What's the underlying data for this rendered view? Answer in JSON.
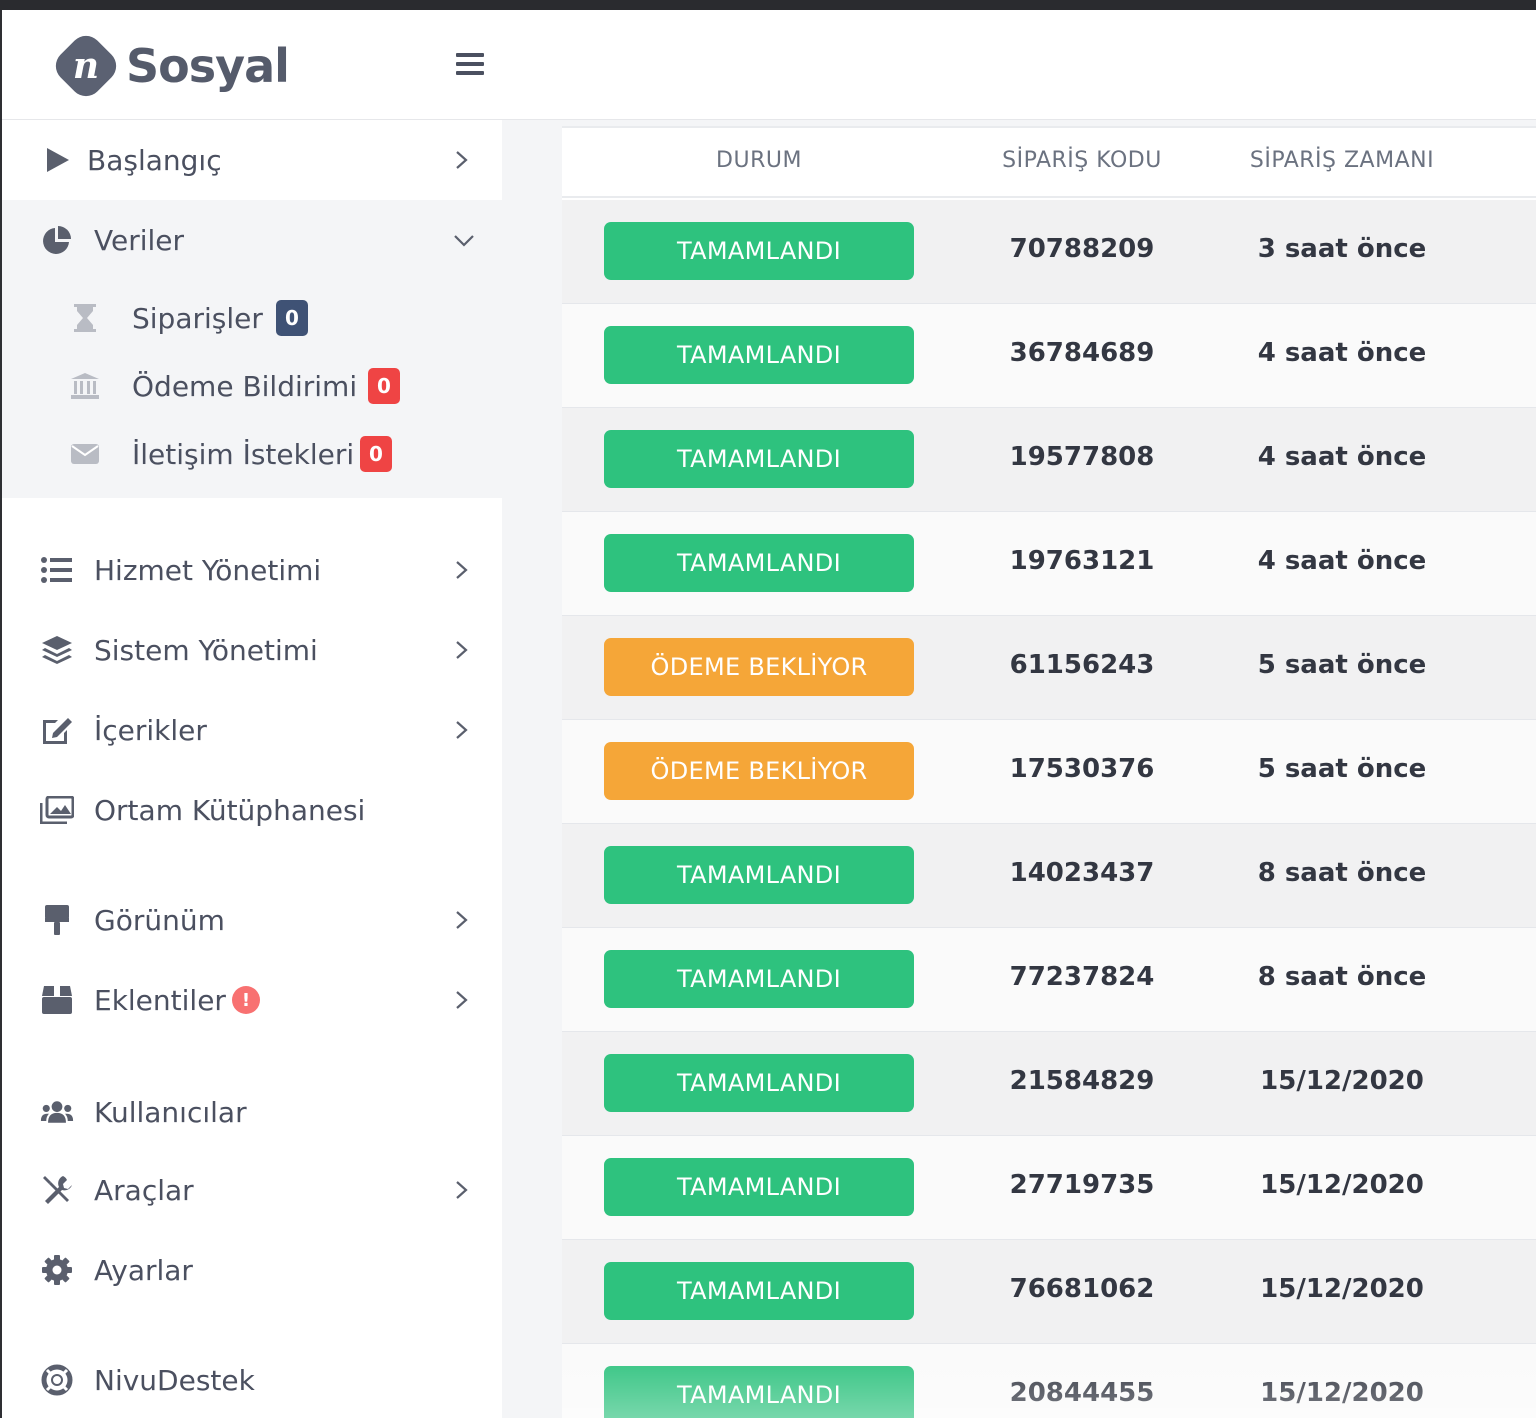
{
  "brand": {
    "name": "Sosyal",
    "logo_letter": "n"
  },
  "header": {
    "menu_icon": "hamburger-icon"
  },
  "sidebar": {
    "items": [
      {
        "key": "baslangic",
        "label": "Başlangıç",
        "icon": "play-icon",
        "chevron": "right"
      },
      {
        "key": "veriler",
        "label": "Veriler",
        "icon": "pie-chart-icon",
        "chevron": "down",
        "children": [
          {
            "key": "siparisler",
            "label": "Siparişler",
            "icon": "hourglass-icon",
            "badge": "0",
            "badge_color": "#3f5275"
          },
          {
            "key": "odeme",
            "label": "Ödeme Bildirimi",
            "icon": "bank-icon",
            "badge": "0",
            "badge_color": "#ef4444"
          },
          {
            "key": "iletisim",
            "label": "İletişim İstekleri",
            "icon": "envelope-icon",
            "badge": "0",
            "badge_color": "#ef4444"
          }
        ]
      },
      {
        "key": "hizmet",
        "label": "Hizmet Yönetimi",
        "icon": "list-icon",
        "chevron": "right"
      },
      {
        "key": "sistem",
        "label": "Sistem Yönetimi",
        "icon": "layers-icon",
        "chevron": "right"
      },
      {
        "key": "icerikler",
        "label": "İçerikler",
        "icon": "edit-icon",
        "chevron": "right"
      },
      {
        "key": "ortam",
        "label": "Ortam Kütüphanesi",
        "icon": "images-icon"
      },
      {
        "key": "gorunum",
        "label": "Görünüm",
        "icon": "paint-roller-icon",
        "chevron": "right"
      },
      {
        "key": "eklentiler",
        "label": "Eklentiler",
        "icon": "box-icon",
        "chevron": "right",
        "alert": "!"
      },
      {
        "key": "kullanicilar",
        "label": "Kullanıcılar",
        "icon": "users-icon"
      },
      {
        "key": "araclar",
        "label": "Araçlar",
        "icon": "tools-icon",
        "chevron": "right"
      },
      {
        "key": "ayarlar",
        "label": "Ayarlar",
        "icon": "gear-icon"
      },
      {
        "key": "destek",
        "label": "NivuDestek",
        "icon": "lifebuoy-icon"
      }
    ]
  },
  "table": {
    "columns": [
      "DURUM",
      "SİPARİŞ KODU",
      "SİPARİŞ ZAMANI"
    ],
    "rows": [
      {
        "status": "TAMAMLANDI",
        "kind": "complete",
        "code": "70788209",
        "time": "3 saat önce"
      },
      {
        "status": "TAMAMLANDI",
        "kind": "complete",
        "code": "36784689",
        "time": "4 saat önce"
      },
      {
        "status": "TAMAMLANDI",
        "kind": "complete",
        "code": "19577808",
        "time": "4 saat önce"
      },
      {
        "status": "TAMAMLANDI",
        "kind": "complete",
        "code": "19763121",
        "time": "4 saat önce"
      },
      {
        "status": "ÖDEME BEKLİYOR",
        "kind": "pending",
        "code": "61156243",
        "time": "5 saat önce"
      },
      {
        "status": "ÖDEME BEKLİYOR",
        "kind": "pending",
        "code": "17530376",
        "time": "5 saat önce"
      },
      {
        "status": "TAMAMLANDI",
        "kind": "complete",
        "code": "14023437",
        "time": "8 saat önce"
      },
      {
        "status": "TAMAMLANDI",
        "kind": "complete",
        "code": "77237824",
        "time": "8 saat önce"
      },
      {
        "status": "TAMAMLANDI",
        "kind": "complete",
        "code": "21584829",
        "time": "15/12/2020"
      },
      {
        "status": "TAMAMLANDI",
        "kind": "complete",
        "code": "27719735",
        "time": "15/12/2020"
      },
      {
        "status": "TAMAMLANDI",
        "kind": "complete",
        "code": "76681062",
        "time": "15/12/2020"
      },
      {
        "status": "TAMAMLANDI",
        "kind": "complete",
        "code": "20844455",
        "time": "15/12/2020"
      }
    ]
  },
  "colors": {
    "complete": "#2ec27e",
    "pending": "#f5a638",
    "sidebar_text": "#4b5060",
    "icon": "#5a5f6d"
  }
}
